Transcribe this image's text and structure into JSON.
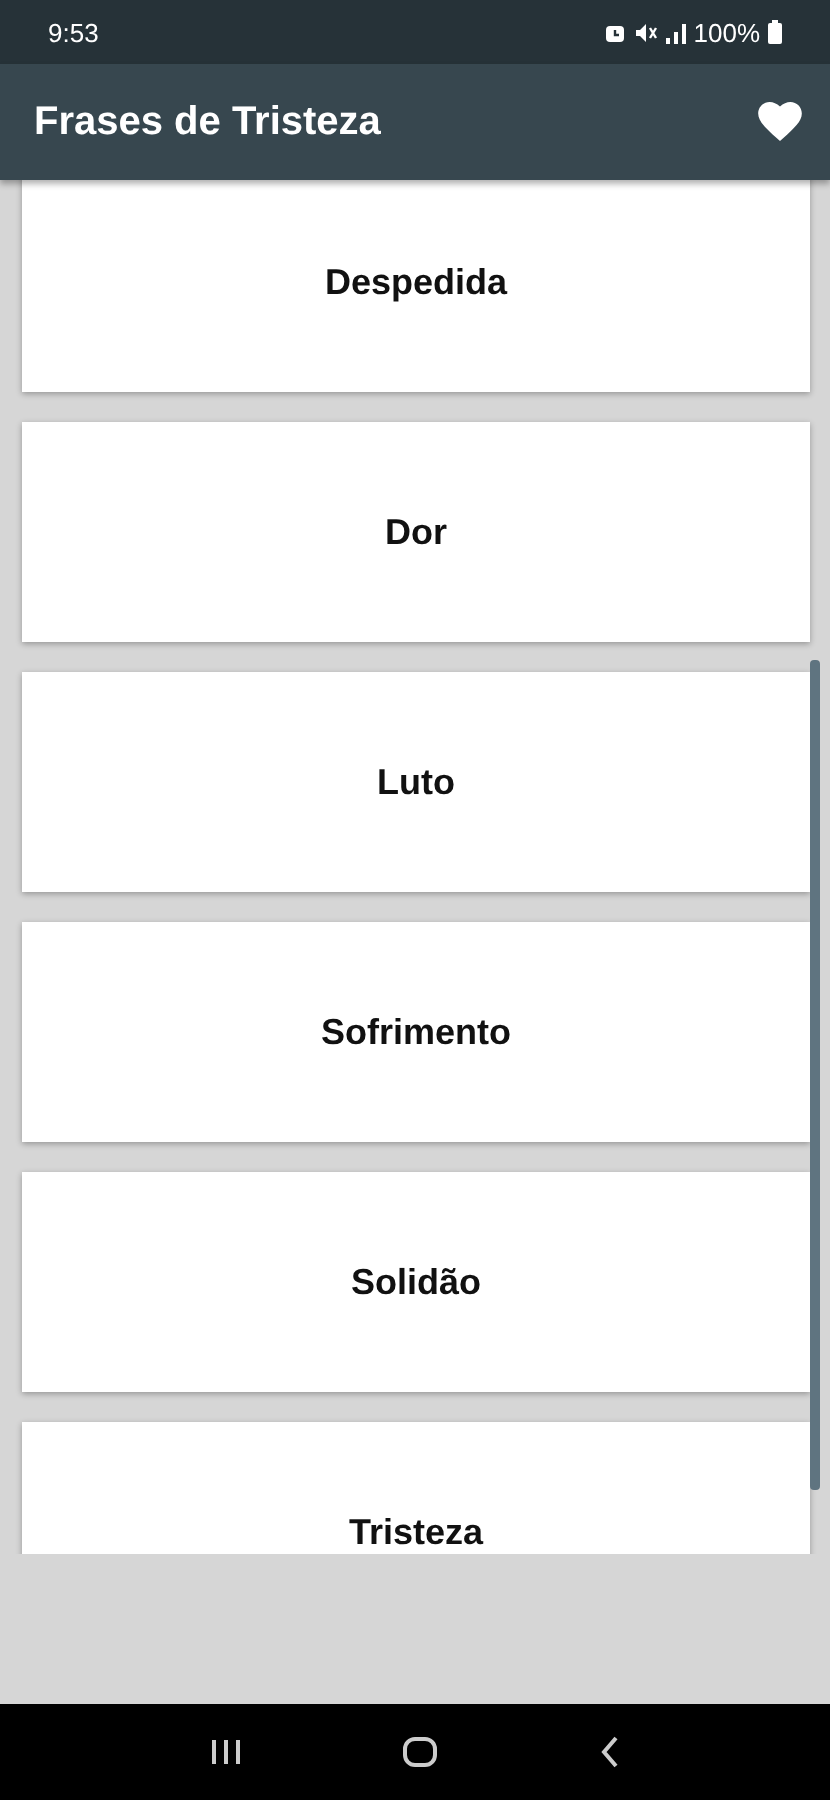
{
  "status_bar": {
    "time": "9:53",
    "battery": "100%"
  },
  "app_bar": {
    "title": "Frases de Tristeza"
  },
  "categories": [
    {
      "label": "Despedida"
    },
    {
      "label": "Dor"
    },
    {
      "label": "Luto"
    },
    {
      "label": "Sofrimento"
    },
    {
      "label": "Solidão"
    },
    {
      "label": "Tristeza"
    }
  ]
}
